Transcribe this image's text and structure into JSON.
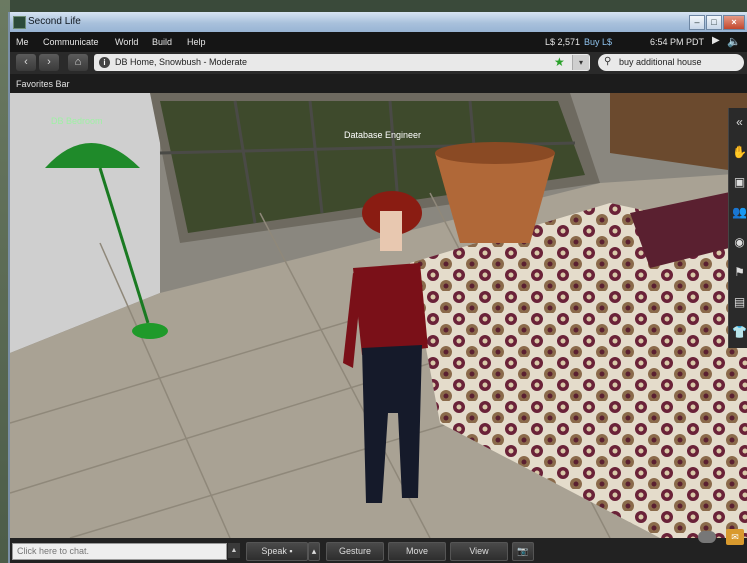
{
  "window": {
    "title": "Second Life"
  },
  "menubar": {
    "items": [
      "Me",
      "Communicate",
      "World",
      "Build",
      "Help"
    ],
    "balance": "L$ 2,571",
    "buy": "Buy L$",
    "time": "6:54 PM PDT"
  },
  "navbar": {
    "location": "DB Home, Snowbush - Moderate",
    "search_placeholder": "buy additional house"
  },
  "favorites": {
    "label": "Favorites Bar"
  },
  "scene": {
    "object_label": "DB Bedroom",
    "avatar_label": "Database Engineer"
  },
  "toolbar": {
    "chat_placeholder": "Click here to chat.",
    "speak": "Speak",
    "gesture": "Gesture",
    "move": "Move",
    "view": "View"
  },
  "colors": {
    "titlebar": "#a9c1dc",
    "menubar": "#151515",
    "buy_link": "#8fc3ee",
    "object_label": "#9ff0a5",
    "favorite_star": "#2aa12a",
    "corner_icon": "#d99a2e"
  },
  "icons": [
    "app-icon",
    "back-icon",
    "forward-icon",
    "home-icon",
    "info-icon",
    "favorite-star-icon",
    "dropdown-icon",
    "search-icon",
    "play-icon",
    "volume-icon",
    "collapse-icon",
    "gesture-hand-icon",
    "profile-icon",
    "people-icon",
    "places-icon",
    "landmarks-icon",
    "inventory-icon",
    "appearance-icon",
    "snapshot-icon",
    "speech-icon",
    "notification-icon"
  ]
}
